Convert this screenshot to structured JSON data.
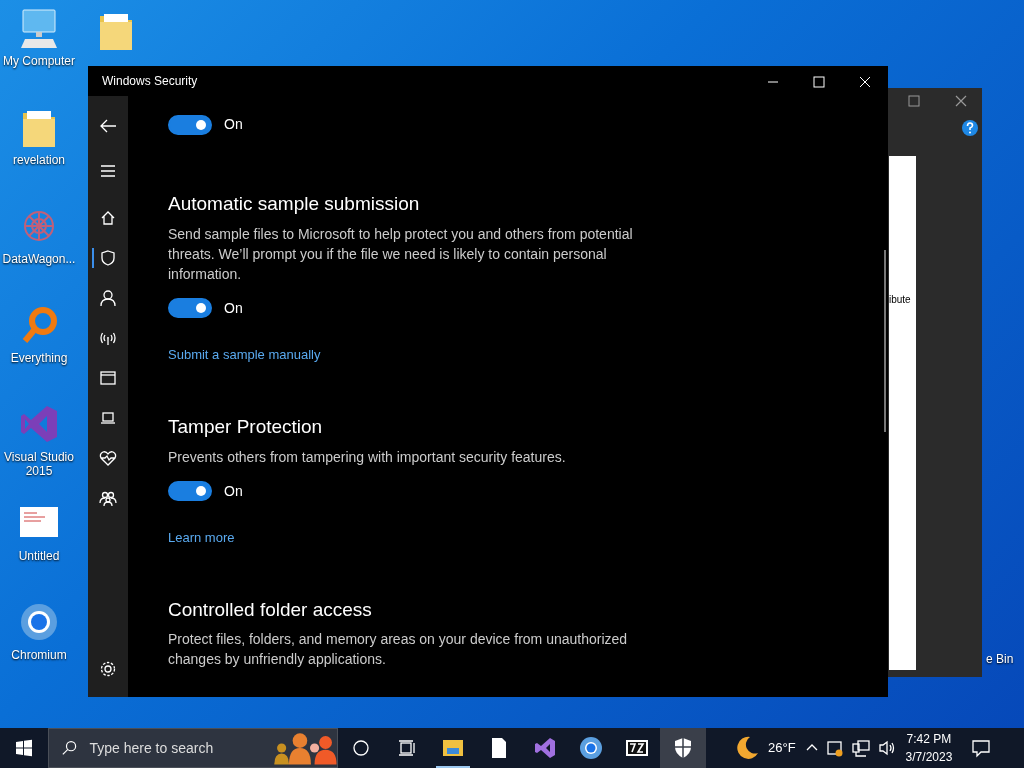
{
  "desktop_icons": [
    {
      "kind": "computer",
      "label": "My Computer"
    },
    {
      "kind": "folder",
      "label": "revelation"
    },
    {
      "kind": "mandala",
      "label": "DataWagon..."
    },
    {
      "kind": "everything",
      "label": "Everything"
    },
    {
      "kind": "vs",
      "label": "Visual Studio 2015"
    },
    {
      "kind": "doc",
      "label": "Untitled"
    },
    {
      "kind": "chromium",
      "label": "Chromium"
    }
  ],
  "background_window": {
    "list_text": "ibute",
    "recycle_label": "e Bin"
  },
  "window": {
    "title": "Windows Security",
    "sidebar": {
      "items": [
        {
          "kind": "home",
          "selected": false
        },
        {
          "kind": "shield",
          "selected": true
        },
        {
          "kind": "person",
          "selected": false
        },
        {
          "kind": "wireless",
          "selected": false
        },
        {
          "kind": "window",
          "selected": false
        },
        {
          "kind": "laptop",
          "selected": false
        },
        {
          "kind": "heart",
          "selected": false
        },
        {
          "kind": "family",
          "selected": false
        }
      ]
    },
    "sections": [
      {
        "toggle": {
          "on": true,
          "label": "On"
        }
      },
      {
        "title": "Automatic sample submission",
        "description": "Send sample files to Microsoft to help protect you and others from potential threats. We’ll prompt you if the file we need is likely to contain personal information.",
        "toggle": {
          "on": true,
          "label": "On"
        },
        "link": "Submit a sample manually"
      },
      {
        "title": "Tamper Protection",
        "description": "Prevents others from tampering with important security features.",
        "toggle": {
          "on": true,
          "label": "On"
        },
        "link": "Learn more"
      },
      {
        "title": "Controlled folder access",
        "description": "Protect files, folders, and memory areas on your device from unauthorized changes by unfriendly applications."
      }
    ]
  },
  "taskbar": {
    "search_placeholder": "Type here to search",
    "apps": [
      {
        "kind": "explorer",
        "active": true,
        "selected": false
      },
      {
        "kind": "notepad",
        "active": false,
        "selected": false
      },
      {
        "kind": "vs",
        "active": false,
        "selected": false
      },
      {
        "kind": "chromium",
        "active": false,
        "selected": false
      },
      {
        "kind": "archive",
        "active": false,
        "selected": false
      },
      {
        "kind": "security",
        "active": false,
        "selected": true
      }
    ],
    "temperature": "26°F",
    "time": "7:42 PM",
    "date": "3/7/2023"
  }
}
